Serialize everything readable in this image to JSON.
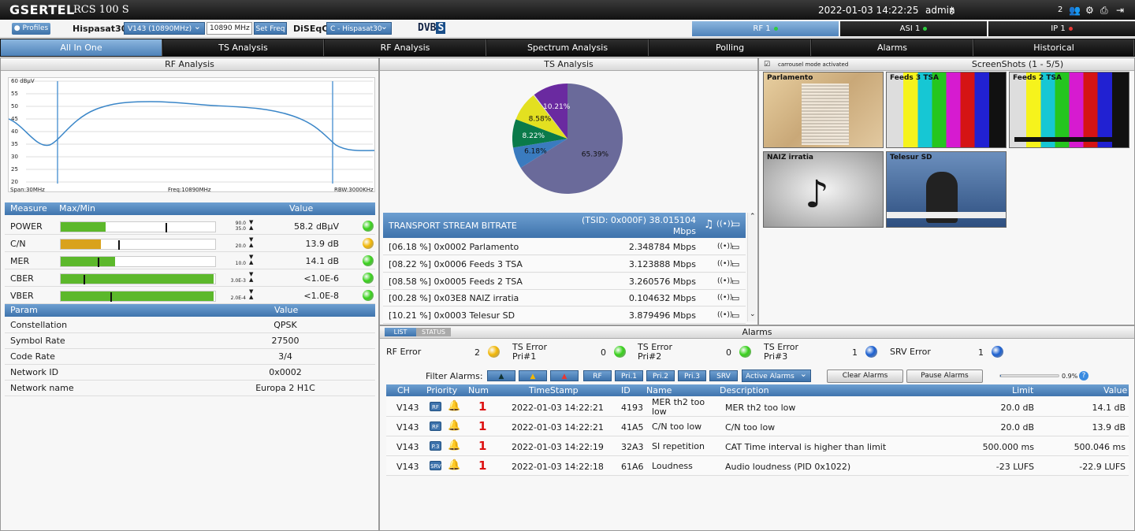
{
  "app": {
    "brand": "GSERTEL",
    "model": "RCS 100 S",
    "datetime": "2022-01-03 14:22:25",
    "user": "admin",
    "alert_count": "2"
  },
  "controls": {
    "profiles": "Profiles",
    "satellite": "Hispasat30",
    "transponder": "V143 (10890MHz)",
    "freq_value": "10890 MHz",
    "setfreq": "Set Freq",
    "diseqc_label": "DiSEqC",
    "diseqc_value": "C - Hispasat30",
    "standard": "DVB",
    "standard_suffix": "S"
  },
  "channels": [
    {
      "label": "RF 1",
      "status_color": "#2ecc40",
      "active": true
    },
    {
      "label": "ASI 1",
      "status_color": "#2ecc40",
      "active": false
    },
    {
      "label": "IP 1",
      "status_color": "#e53935",
      "active": false
    }
  ],
  "nav": [
    "All In One",
    "TS Analysis",
    "RF Analysis",
    "Spectrum Analysis",
    "Polling",
    "Alarms",
    "Historical"
  ],
  "rf": {
    "title": "RF Analysis",
    "spectrum": {
      "unit": "dBμV",
      "y_ticks": [
        "60",
        "55",
        "50",
        "45",
        "40",
        "35",
        "30",
        "25",
        "20"
      ],
      "span": "Span:30MHz",
      "freq": "Freq:10890MHz",
      "rbw": "RBW:3000KHz"
    },
    "measure_header": {
      "measure": "Measure",
      "maxmin": "Max/Min",
      "value": "Value"
    },
    "measures": [
      {
        "name": "POWER",
        "max": "90.0",
        "min": "35.0",
        "value": "58.2 dBμV",
        "fill": 0.29,
        "tick_pos": 0.68,
        "bar_color": "#5cb82b",
        "led": "#37d11a"
      },
      {
        "name": "C/N",
        "max": "",
        "min": "20.0",
        "value": "13.9 dB",
        "fill": 0.26,
        "tick_pos": 0.37,
        "bar_color": "#d9a21c",
        "led": "#f2b705"
      },
      {
        "name": "MER",
        "max": "",
        "min": "10.0",
        "value": "14.1 dB",
        "fill": 0.35,
        "tick_pos": 0.24,
        "bar_color": "#5cb82b",
        "led": "#37d11a"
      },
      {
        "name": "CBER",
        "max": "",
        "min": "3.0E-3",
        "value": "<1.0E-6",
        "fill": 0.99,
        "tick_pos": 0.15,
        "bar_color": "#5cb82b",
        "led": "#37d11a"
      },
      {
        "name": "VBER",
        "max": "",
        "min": "2.0E-4",
        "value": "<1.0E-8",
        "fill": 0.99,
        "tick_pos": 0.32,
        "bar_color": "#5cb82b",
        "led": "#37d11a"
      }
    ],
    "param_header": {
      "param": "Param",
      "value": "Value"
    },
    "params": [
      {
        "name": "Constellation",
        "value": "QPSK"
      },
      {
        "name": "Symbol Rate",
        "value": "27500"
      },
      {
        "name": "Code Rate",
        "value": "3/4"
      },
      {
        "name": "Network ID",
        "value": "0x0002"
      },
      {
        "name": "Network name",
        "value": "Europa 2 H1C"
      }
    ]
  },
  "ts": {
    "title": "TS Analysis",
    "bitrate_title": "TRANSPORT STREAM BITRATE",
    "tsid": "(TSID: 0x000F) 38.015104",
    "tsid_unit": "Mbps",
    "services": [
      {
        "label": "[06.18 %] 0x0002 Parlamento",
        "rate": "2.348784 Mbps"
      },
      {
        "label": "[08.22 %] 0x0006 Feeds 3 TSA",
        "rate": "3.123888 Mbps"
      },
      {
        "label": "[08.58 %] 0x0005 Feeds 2 TSA",
        "rate": "3.260576 Mbps"
      },
      {
        "label": "[00.28 %] 0x03E8 NAIZ irratia",
        "rate": "0.104632 Mbps"
      },
      {
        "label": "[10.21 %] 0x0003 Telesur SD",
        "rate": "3.879496 Mbps"
      }
    ]
  },
  "chart_data": {
    "type": "pie",
    "categories": [
      "other",
      "Parlamento",
      "Feeds 3 TSA",
      "Feeds 2 TSA",
      "NAIZ irratia",
      "Telesur SD"
    ],
    "values": [
      65.39,
      6.18,
      8.22,
      8.58,
      0.28,
      10.21
    ],
    "labels": [
      "65.39%",
      "6.18%",
      "8.22%",
      "8.58%",
      "",
      "10.21%"
    ],
    "colors": [
      "#6a6a9a",
      "#3a7bbf",
      "#0a7a4a",
      "#e3e020",
      "#dddddd",
      "#6a2aa0"
    ]
  },
  "screenshots": {
    "mode": "carrousel mode activated",
    "title": "ScreenShots (1 - 5/5)",
    "items": [
      "Parlamento",
      "Feeds 3 TSA",
      "Feeds 2 TSA",
      "NAIZ irratia",
      "Telesur SD"
    ]
  },
  "alarms": {
    "title": "Alarms",
    "tabs": [
      "LIST",
      "STATUS"
    ],
    "chips": [
      {
        "label": "RF Error",
        "count": "2",
        "color": "#f2b705"
      },
      {
        "label": "TS Error\nPri#1",
        "count": "0",
        "color": "#37d11a"
      },
      {
        "label": "TS Error\nPri#2",
        "count": "0",
        "color": "#37d11a"
      },
      {
        "label": "TS Error\nPri#3",
        "count": "1",
        "color": "#1a5fd1"
      },
      {
        "label": "SRV Error",
        "count": "1",
        "color": "#1a5fd1"
      }
    ],
    "filter_label": "Filter Alarms:",
    "filters": [
      "RF",
      "Pri.1",
      "Pri.2",
      "Pri.3",
      "SRV"
    ],
    "active_select": "Active Alarms",
    "clear": "Clear Alarms",
    "pause": "Pause Alarms",
    "progress": "0.9%",
    "progress_value": 0.9,
    "columns": [
      "CH",
      "Priority",
      "Num",
      "TimeStamp",
      "ID",
      "Name",
      "Description",
      "Limit",
      "Value"
    ],
    "rows": [
      {
        "ch": "V143",
        "badge": "RF",
        "bell": "#f2b705",
        "num": "1",
        "ts": "2022-01-03 14:22:21",
        "id": "4193",
        "name": "MER th2 too low",
        "desc": "MER th2 too low",
        "limit": "20.0 dB",
        "value": "14.1 dB"
      },
      {
        "ch": "V143",
        "badge": "RF",
        "bell": "#f2b705",
        "num": "1",
        "ts": "2022-01-03 14:22:21",
        "id": "41A5",
        "name": "C/N too low",
        "desc": "C/N too low",
        "limit": "20.0 dB",
        "value": "13.9 dB"
      },
      {
        "ch": "V143",
        "badge": "P.3",
        "bell": "#2a60b8",
        "num": "1",
        "ts": "2022-01-03 14:22:19",
        "id": "32A3",
        "name": "SI repetition",
        "desc": "CAT Time interval is higher than limit",
        "limit": "500.000 ms",
        "value": "500.046 ms"
      },
      {
        "ch": "V143",
        "badge": "SRV",
        "bell": "#2a60b8",
        "num": "1",
        "ts": "2022-01-03 14:22:18",
        "id": "61A6",
        "name": "Loudness",
        "desc": "Audio loudness (PID 0x1022)",
        "limit": "-23 LUFS",
        "value": "-22.9 LUFS"
      }
    ]
  }
}
